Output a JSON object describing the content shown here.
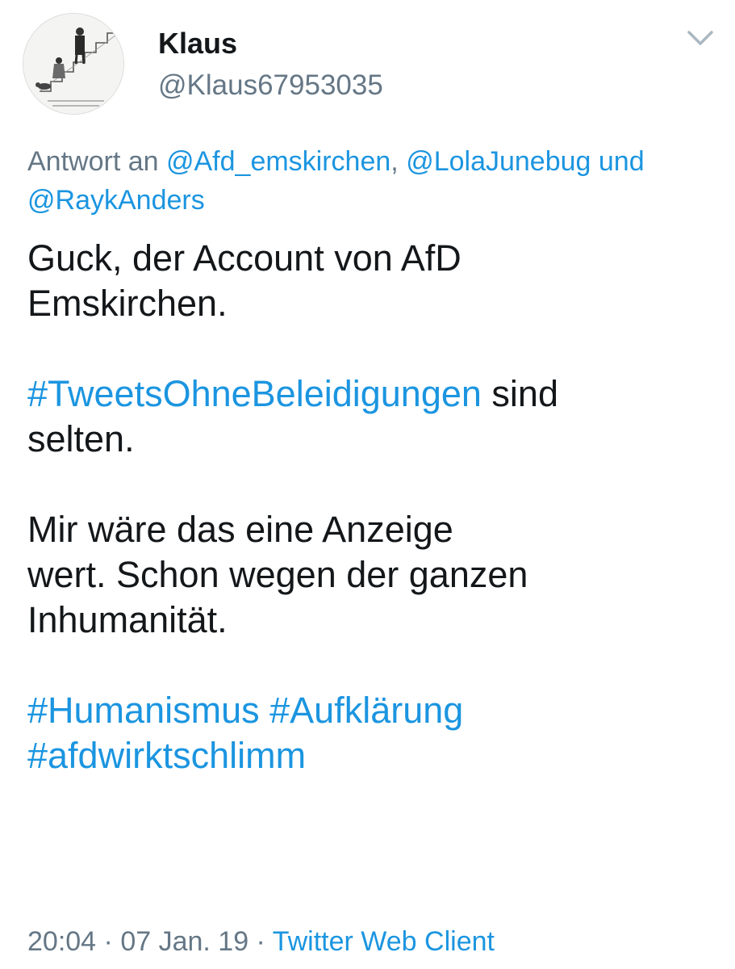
{
  "author": {
    "display_name": "Klaus",
    "handle": "@Klaus67953035",
    "avatar_icon": "cartoon-staircase-avatar"
  },
  "menu": {
    "icon": "chevron-down-icon"
  },
  "reply_to": {
    "prefix": "Antwort an ",
    "mention_1": "@Afd_emskirchen",
    "sep_1": ", ",
    "mention_2": "@LolaJunebug",
    "sep_2": " und",
    "mention_3": "@RaykAnders"
  },
  "body": {
    "line_1": "Guck, der Account von AfD",
    "line_2": "Emskirchen.",
    "hashtag_1": "#TweetsOhneBeleidigungen",
    "after_hashtag_1": " sind",
    "line_4": "selten.",
    "line_5": "Mir wäre das eine Anzeige",
    "line_6": "wert. Schon wegen der ganzen",
    "line_7": "Inhumanität.",
    "hashtag_2": "#Humanismus",
    "hashtag_3": "#Aufklärung",
    "hashtag_4": "#afdwirktschlimm"
  },
  "meta": {
    "time": "20:04",
    "separator": " · ",
    "date": "07 Jan. 19",
    "separator_2": " · ",
    "client": "Twitter Web Client"
  },
  "colors": {
    "link": "#1b95e0",
    "secondary": "#657786",
    "text": "#14171a"
  }
}
